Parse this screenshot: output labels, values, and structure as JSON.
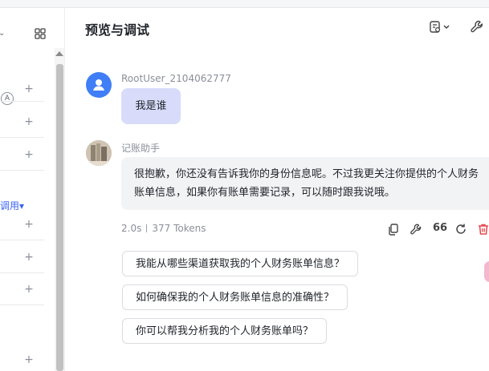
{
  "header": {
    "title": "预览与调试"
  },
  "left_panel": {
    "call_label": "调用▾",
    "badge_letter": "A",
    "plus_glyph": "+"
  },
  "chat": {
    "user": {
      "name": "RootUser_2104062777",
      "message": "我是谁"
    },
    "bot": {
      "name": "记账助手",
      "message": "很抱歉，你还没有告诉我你的身份信息呢。不过我更关注你提供的个人财务账单信息，如果你有账单需要记录，可以随时跟我说哦。",
      "duration": "2.0s",
      "tokens": "377 Tokens",
      "actions": [
        "copy-icon",
        "wrench-icon",
        "quote-icon",
        "refresh-icon",
        "delete-icon"
      ],
      "quote_glyph": "66"
    }
  },
  "suggestions": [
    "我能从哪些渠道获取我的个人财务账单信息？",
    "如何确保我的个人财务账单信息的准确性？",
    "你可以帮我分析我的个人财务账单吗？"
  ],
  "colors": {
    "accent": "#3f7ef7",
    "user_bubble": "#d8dcfa",
    "bot_bubble": "#f2f3f5",
    "delete": "#e5484d"
  }
}
